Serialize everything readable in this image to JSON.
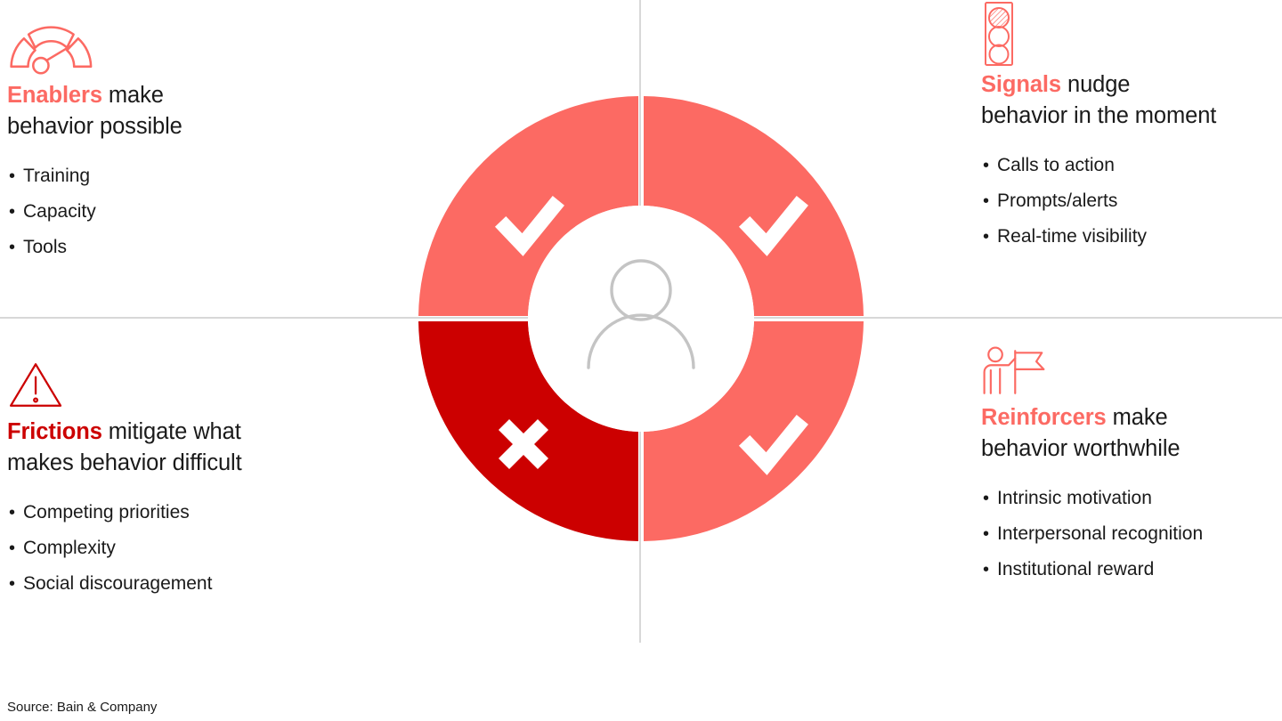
{
  "quadrants": [
    {
      "id": "enablers",
      "icon": "gauge-icon",
      "keyword": "Enablers",
      "keyword_color": "#fc6a63",
      "heading_rest": " make",
      "heading_line2": "behavior possible",
      "bullets": [
        "Training",
        "Capacity",
        "Tools"
      ]
    },
    {
      "id": "signals",
      "icon": "traffic-light-icon",
      "keyword": "Signals",
      "keyword_color": "#fc6a63",
      "heading_rest": " nudge",
      "heading_line2": "behavior in the moment",
      "bullets": [
        "Calls to action",
        "Prompts/alerts",
        "Real-time visibility"
      ]
    },
    {
      "id": "frictions",
      "icon": "warning-triangle-icon",
      "keyword": "Frictions",
      "keyword_color": "#cc0000",
      "heading_rest": " mitigate what",
      "heading_line2": "makes behavior difficult",
      "bullets": [
        "Competing priorities",
        "Complexity",
        "Social discouragement"
      ]
    },
    {
      "id": "reinforcers",
      "icon": "person-flag-icon",
      "keyword": "Reinforcers",
      "keyword_color": "#fc6a63",
      "heading_rest": " make",
      "heading_line2": "behavior worthwhile",
      "bullets": [
        "Intrinsic motivation",
        "Interpersonal recognition",
        "Institutional reward"
      ]
    }
  ],
  "chart_data": {
    "type": "pie",
    "title": "",
    "categories": [
      "Enablers",
      "Signals",
      "Reinforcers",
      "Frictions"
    ],
    "values": [
      25,
      25,
      25,
      25
    ],
    "segments": [
      {
        "label": "Enablers",
        "quadrant": "top-left",
        "color": "#fc6a63",
        "mark": "check"
      },
      {
        "label": "Signals",
        "quadrant": "top-right",
        "color": "#fc6a63",
        "mark": "check"
      },
      {
        "label": "Reinforcers",
        "quadrant": "bottom-right",
        "color": "#fc6a63",
        "mark": "check"
      },
      {
        "label": "Frictions",
        "quadrant": "bottom-left",
        "color": "#cc0000",
        "mark": "cross"
      }
    ],
    "center_icon": "person-icon",
    "legend": "none",
    "grid": false
  },
  "colors": {
    "accent_light": "#fc6a63",
    "accent_dark": "#cc0000",
    "divider": "#d8d8d8",
    "center_figure": "#c4c4c4",
    "text": "#1a1a1a"
  },
  "source": {
    "text": "Source: Bain & Company"
  }
}
